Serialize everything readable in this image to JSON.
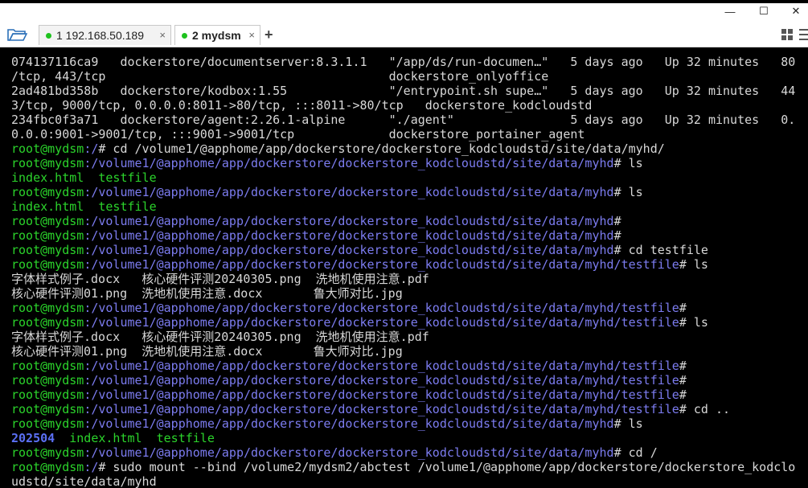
{
  "window": {
    "minimize_label": "—",
    "maximize_label": "☐",
    "close_label": "✕"
  },
  "tabs": [
    {
      "label": "1 192.168.50.189",
      "close": "×",
      "status_color": "#1ec21e"
    },
    {
      "label": "2 mydsm",
      "close": "×",
      "status_color": "#1ec21e"
    }
  ],
  "add_tab_label": "+",
  "icons": {
    "folder": "folder-open-icon",
    "grid": "grid-view-icon",
    "menu": "menu-icon"
  },
  "colors": {
    "prompt_user": "#2bd32b",
    "prompt_path": "#7c7cf0",
    "terminal_bg": "#000000"
  },
  "terminal": {
    "lines": [
      {
        "type": "plain",
        "text": "074137116ca9   dockerstore/documentserver:8.3.1.1   \"/app/ds/run-documen…\"   5 days ago   Up 32 minutes   80"
      },
      {
        "type": "plain",
        "text": "/tcp, 443/tcp                                       dockerstore_onlyoffice"
      },
      {
        "type": "plain",
        "text": "2ad481bd358b   dockerstore/kodbox:1.55              \"/entrypoint.sh supe…\"   5 days ago   Up 32 minutes   44"
      },
      {
        "type": "plain",
        "text": "3/tcp, 9000/tcp, 0.0.0.0:8011->80/tcp, :::8011->80/tcp   dockerstore_kodcloudstd"
      },
      {
        "type": "plain",
        "text": "234fbc0f3a71   dockerstore/agent:2.26.1-alpine      \"./agent\"                5 days ago   Up 32 minutes   0."
      },
      {
        "type": "plain",
        "text": "0.0.0:9001->9001/tcp, :::9001->9001/tcp             dockerstore_portainer_agent"
      },
      {
        "type": "prompt",
        "user": "root@mydsm",
        "path": ":/",
        "cmd": "# cd /volume1/@apphome/app/dockerstore/dockerstore_kodcloudstd/site/data/myhd/"
      },
      {
        "type": "prompt",
        "user": "root@mydsm",
        "path": ":/volume1/@apphome/app/dockerstore/dockerstore_kodcloudstd/site/data/myhd",
        "cmd": "# ls"
      },
      {
        "type": "ls",
        "items": [
          {
            "name": "index.html",
            "kind": "file"
          },
          {
            "name": "testfile",
            "kind": "file"
          }
        ]
      },
      {
        "type": "prompt",
        "user": "root@mydsm",
        "path": ":/volume1/@apphome/app/dockerstore/dockerstore_kodcloudstd/site/data/myhd",
        "cmd": "# ls"
      },
      {
        "type": "ls",
        "items": [
          {
            "name": "index.html",
            "kind": "file"
          },
          {
            "name": "testfile",
            "kind": "file"
          }
        ]
      },
      {
        "type": "prompt",
        "user": "root@mydsm",
        "path": ":/volume1/@apphome/app/dockerstore/dockerstore_kodcloudstd/site/data/myhd",
        "cmd": "#"
      },
      {
        "type": "prompt",
        "user": "root@mydsm",
        "path": ":/volume1/@apphome/app/dockerstore/dockerstore_kodcloudstd/site/data/myhd",
        "cmd": "#"
      },
      {
        "type": "prompt",
        "user": "root@mydsm",
        "path": ":/volume1/@apphome/app/dockerstore/dockerstore_kodcloudstd/site/data/myhd",
        "cmd": "# cd testfile"
      },
      {
        "type": "prompt",
        "user": "root@mydsm",
        "path": ":/volume1/@apphome/app/dockerstore/dockerstore_kodcloudstd/site/data/myhd/testfile",
        "cmd": "# ls"
      },
      {
        "type": "plain",
        "text": "字体样式例子.docx   核心硬件评测20240305.png  洗地机使用注意.pdf"
      },
      {
        "type": "plain",
        "text": "核心硬件评测01.png  洗地机使用注意.docx       鲁大师对比.jpg"
      },
      {
        "type": "prompt",
        "user": "root@mydsm",
        "path": ":/volume1/@apphome/app/dockerstore/dockerstore_kodcloudstd/site/data/myhd/testfile",
        "cmd": "#"
      },
      {
        "type": "prompt",
        "user": "root@mydsm",
        "path": ":/volume1/@apphome/app/dockerstore/dockerstore_kodcloudstd/site/data/myhd/testfile",
        "cmd": "# ls"
      },
      {
        "type": "plain",
        "text": "字体样式例子.docx   核心硬件评测20240305.png  洗地机使用注意.pdf"
      },
      {
        "type": "plain",
        "text": "核心硬件评测01.png  洗地机使用注意.docx       鲁大师对比.jpg"
      },
      {
        "type": "prompt",
        "user": "root@mydsm",
        "path": ":/volume1/@apphome/app/dockerstore/dockerstore_kodcloudstd/site/data/myhd/testfile",
        "cmd": "#"
      },
      {
        "type": "prompt",
        "user": "root@mydsm",
        "path": ":/volume1/@apphome/app/dockerstore/dockerstore_kodcloudstd/site/data/myhd/testfile",
        "cmd": "#"
      },
      {
        "type": "prompt",
        "user": "root@mydsm",
        "path": ":/volume1/@apphome/app/dockerstore/dockerstore_kodcloudstd/site/data/myhd/testfile",
        "cmd": "#"
      },
      {
        "type": "prompt",
        "user": "root@mydsm",
        "path": ":/volume1/@apphome/app/dockerstore/dockerstore_kodcloudstd/site/data/myhd/testfile",
        "cmd": "# cd .."
      },
      {
        "type": "prompt",
        "user": "root@mydsm",
        "path": ":/volume1/@apphome/app/dockerstore/dockerstore_kodcloudstd/site/data/myhd",
        "cmd": "# ls"
      },
      {
        "type": "ls",
        "items": [
          {
            "name": "202504",
            "kind": "dir"
          },
          {
            "name": "index.html",
            "kind": "file"
          },
          {
            "name": "testfile",
            "kind": "file"
          }
        ]
      },
      {
        "type": "prompt",
        "user": "root@mydsm",
        "path": ":/volume1/@apphome/app/dockerstore/dockerstore_kodcloudstd/site/data/myhd",
        "cmd": "# cd /"
      },
      {
        "type": "prompt",
        "user": "root@mydsm",
        "path": ":/",
        "cmd": "# sudo mount --bind /volume2/mydsm2/abctest /volume1/@apphome/app/dockerstore/dockerstore_kodclo"
      },
      {
        "type": "plain",
        "text": "udstd/site/data/myhd"
      }
    ]
  }
}
